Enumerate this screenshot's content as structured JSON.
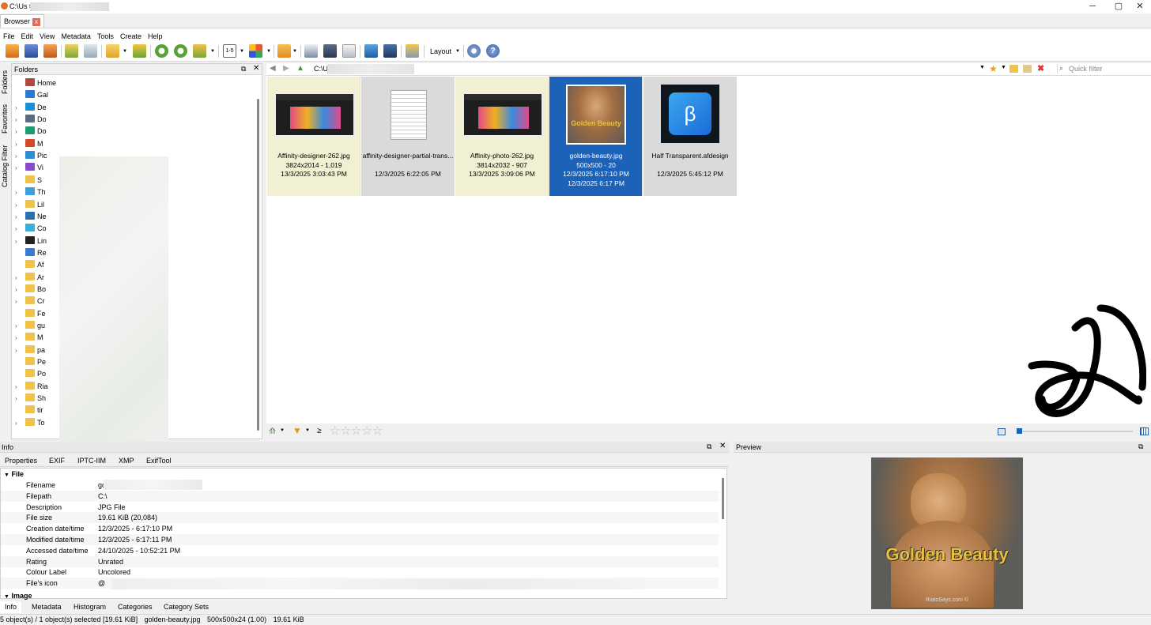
{
  "window": {
    "title": "C:\\Us                    ty\\ - XnView MP",
    "minimize": "─",
    "maximize": "▢",
    "close": "✕"
  },
  "tabs": {
    "browser": "Browser",
    "close": "x"
  },
  "menu": [
    "File",
    "Edit",
    "View",
    "Metadata",
    "Tools",
    "Create",
    "Help"
  ],
  "toolbar": {
    "layout_label": "Layout",
    "page_range": "1-5"
  },
  "left_tabs": [
    "Folders",
    "Favorites",
    "Catalog Filter"
  ],
  "folders": {
    "header": "Folders",
    "items": [
      {
        "label": "Home",
        "chev": "",
        "color": "#b04a3a"
      },
      {
        "label": "Gal",
        "chev": "",
        "color": "#2a7bd0"
      },
      {
        "label": "De",
        "chev": "›",
        "color": "#1a8fd6"
      },
      {
        "label": "Do",
        "chev": "›",
        "color": "#5a6d80"
      },
      {
        "label": "Do",
        "chev": "›",
        "color": "#1b9c74"
      },
      {
        "label": "M",
        "chev": "›",
        "color": "#d24a2a"
      },
      {
        "label": "Pic",
        "chev": "›",
        "color": "#2a8fd6"
      },
      {
        "label": "Vi",
        "chev": "›",
        "color": "#8a4ad0"
      },
      {
        "label": "S",
        "chev": "",
        "color": "#f0c24a"
      },
      {
        "label": "Th",
        "chev": "›",
        "color": "#3aa0d8"
      },
      {
        "label": "Lil",
        "chev": "›",
        "color": "#f0c24a"
      },
      {
        "label": "Ne",
        "chev": "›",
        "color": "#2a6fb0"
      },
      {
        "label": "Co",
        "chev": "›",
        "color": "#3ab0d8"
      },
      {
        "label": "Lin",
        "chev": "›",
        "color": "#222222"
      },
      {
        "label": "Re",
        "chev": "",
        "color": "#3a7ad0"
      },
      {
        "label": "Af",
        "chev": "",
        "color": "#f0c24a"
      },
      {
        "label": "Ar",
        "chev": "›",
        "color": "#f0c24a"
      },
      {
        "label": "Bo",
        "chev": "›",
        "color": "#f0c24a"
      },
      {
        "label": "Cr",
        "chev": "›",
        "color": "#f0c24a"
      },
      {
        "label": "Fe",
        "chev": "",
        "color": "#f0c24a"
      },
      {
        "label": "gu",
        "chev": "›",
        "color": "#f0c24a"
      },
      {
        "label": "M",
        "chev": "›",
        "color": "#f0c24a"
      },
      {
        "label": "pa",
        "chev": "›",
        "color": "#f0c24a"
      },
      {
        "label": "Pe",
        "chev": "",
        "color": "#f0c24a"
      },
      {
        "label": "Po",
        "chev": "",
        "color": "#f0c24a"
      },
      {
        "label": "Ria",
        "chev": "›",
        "color": "#f0c24a"
      },
      {
        "label": "Sh",
        "chev": "›",
        "color": "#f0c24a"
      },
      {
        "label": "tir",
        "chev": "",
        "color": "#f0c24a"
      },
      {
        "label": "To",
        "chev": "›",
        "color": "#f0c24a"
      }
    ]
  },
  "address": {
    "path": "C:\\U",
    "quick_filter_placeholder": "Quick filter"
  },
  "thumbnails": [
    {
      "name": "Affinity-designer-262.jpg",
      "dims": "3824x2014 - 1,019",
      "date": "13/3/2025 3:03:43 PM",
      "date2": "",
      "state": "normal",
      "kind": "screen"
    },
    {
      "name": "affinity-designer-partial-trans...",
      "dims": "",
      "date": "12/3/2025 6:22:05 PM",
      "date2": "",
      "state": "gray",
      "kind": "doc"
    },
    {
      "name": "Affinity-photo-262.jpg",
      "dims": "3814x2032 - 907",
      "date": "13/3/2025 3:09:06 PM",
      "date2": "",
      "state": "normal",
      "kind": "screen"
    },
    {
      "name": "golden-beauty.jpg",
      "dims": "500x500 - 20",
      "date": "12/3/2025 6:17:10 PM",
      "date2": "12/3/2025 6:17 PM",
      "state": "selected",
      "kind": "cat"
    },
    {
      "name": "Half Transparent.afdesign",
      "dims": "",
      "date": "12/3/2025 5:45:12 PM",
      "date2": "",
      "state": "gray",
      "kind": "afdesign"
    }
  ],
  "browse_bottom": {
    "ge": "≥",
    "stars": "☆☆☆☆☆"
  },
  "info": {
    "header": "Info",
    "tabs": [
      "Properties",
      "EXIF",
      "IPTC-IIM",
      "XMP",
      "ExifTool"
    ],
    "section_file": "File",
    "section_image": "Image",
    "rows": [
      {
        "key": "Filename",
        "value": "golden-beauty.jpg"
      },
      {
        "key": "Filepath",
        "value": "C:\\"
      },
      {
        "key": "Description",
        "value": "JPG File"
      },
      {
        "key": "File size",
        "value": "19.61 KiB (20,084)"
      },
      {
        "key": "Creation date/time",
        "value": "12/3/2025 - 6:17:10 PM"
      },
      {
        "key": "Modified date/time",
        "value": "12/3/2025 - 6:17:11 PM"
      },
      {
        "key": "Accessed date/time",
        "value": "24/10/2025 - 10:52:21 PM"
      },
      {
        "key": "Rating",
        "value": "Unrated"
      },
      {
        "key": "Colour Label",
        "value": "Uncolored"
      },
      {
        "key": "File's icon",
        "value": "@"
      }
    ]
  },
  "bottom_tabs": [
    "Info",
    "Metadata",
    "Histogram",
    "Categories",
    "Category Sets"
  ],
  "preview": {
    "header": "Preview",
    "image_text": "Golden Beauty",
    "watermark": "RiatoSays.com ©"
  },
  "status": {
    "objects": "5 object(s) / 1 object(s) selected [19.61 KiB]",
    "filename": "golden-beauty.jpg",
    "dims": "500x500x24 (1.00)",
    "size": "19.61 KiB"
  },
  "colors": {
    "selection": "#1b62b8",
    "thumb_bg": "#f1f0d2",
    "gray_bg": "#dadada"
  }
}
